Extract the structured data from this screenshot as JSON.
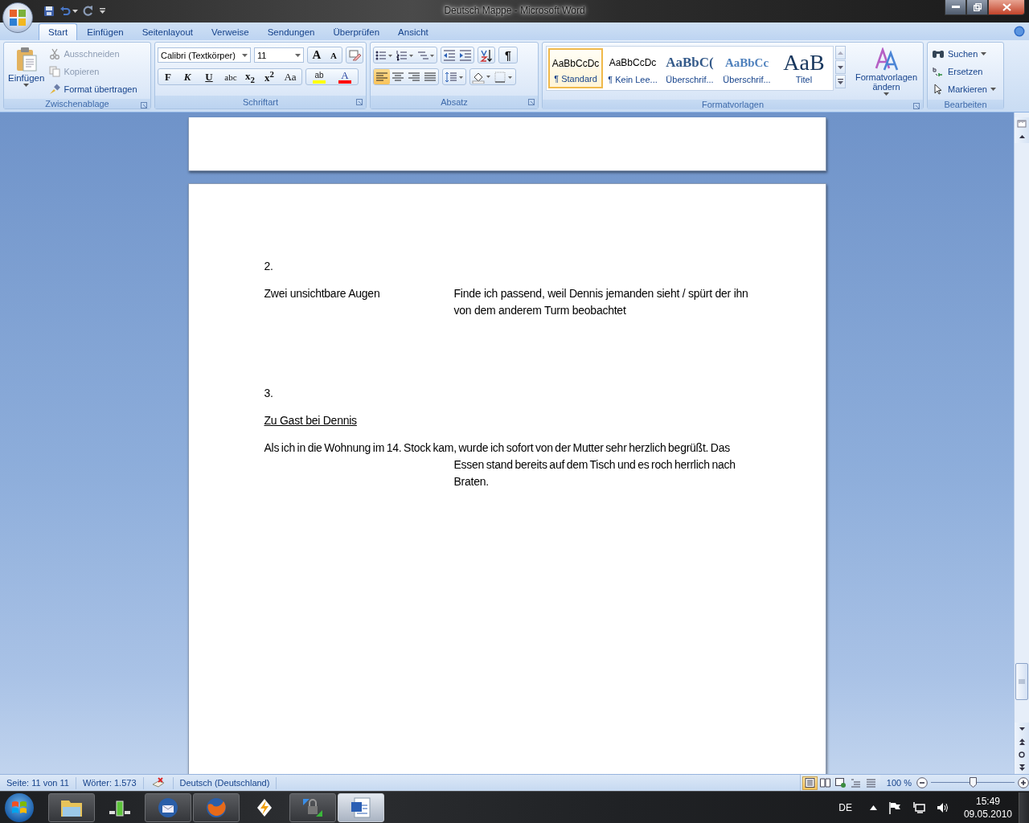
{
  "window": {
    "title": "Deutsch Mappe - Microsoft Word"
  },
  "tabs": [
    {
      "label": "Start",
      "selected": true
    },
    {
      "label": "Einfügen",
      "selected": false
    },
    {
      "label": "Seitenlayout",
      "selected": false
    },
    {
      "label": "Verweise",
      "selected": false
    },
    {
      "label": "Sendungen",
      "selected": false
    },
    {
      "label": "Überprüfen",
      "selected": false
    },
    {
      "label": "Ansicht",
      "selected": false
    }
  ],
  "clipboard": {
    "label": "Zwischenablage",
    "paste": "Einfügen",
    "actions": [
      {
        "label": "Ausschneiden",
        "kind": "cut",
        "disabled": true
      },
      {
        "label": "Kopieren",
        "kind": "copy",
        "disabled": true
      },
      {
        "label": "Format übertragen",
        "kind": "brush",
        "disabled": false
      }
    ]
  },
  "font": {
    "label": "Schriftart",
    "font_name": "Calibri (Textkörper)",
    "font_size": "11",
    "grow": "A",
    "shrink": "A",
    "format_buttons": [
      {
        "text": "F",
        "kind": "bold"
      },
      {
        "text": "K",
        "kind": "italic"
      },
      {
        "text": "U",
        "kind": "underline"
      },
      {
        "text": "abc",
        "kind": "strike"
      },
      {
        "text": "x$_{2}$",
        "kind": "plain"
      },
      {
        "text": "x$^{2}$",
        "kind": "plain"
      },
      {
        "text": "Aa",
        "kind": "case"
      }
    ],
    "highlight": "ab",
    "font_color": "A"
  },
  "paragraph": {
    "label": "Absatz",
    "show_marks": "¶",
    "align": [
      {
        "kind": "left",
        "selected": true
      },
      {
        "kind": "center",
        "selected": false
      },
      {
        "kind": "right",
        "selected": false
      },
      {
        "kind": "justify",
        "selected": false
      }
    ]
  },
  "styles": {
    "label": "Formatvorlagen",
    "change": "Formatvorlagen ändern",
    "items": [
      {
        "preview": "AaBbCcDc",
        "name": "¶ Standard",
        "kind": "normal",
        "selected": true
      },
      {
        "preview": "AaBbCcDc",
        "name": "¶ Kein Lee...",
        "kind": "normal",
        "selected": false
      },
      {
        "preview": "AaBbC(",
        "name": "Überschrif...",
        "kind": "heading1",
        "selected": false
      },
      {
        "preview": "AaBbCc",
        "name": "Überschrif...",
        "kind": "heading2",
        "selected": false
      },
      {
        "preview": "AaB",
        "name": "Titel",
        "kind": "title",
        "selected": false
      }
    ]
  },
  "editing": {
    "label": "Bearbeiten",
    "actions": [
      {
        "label": "Suchen",
        "kind": "find"
      },
      {
        "label": "Ersetzen",
        "kind": "replace"
      },
      {
        "label": "Markieren",
        "kind": "select"
      }
    ]
  },
  "document": {
    "blocks": [
      {
        "kind": "para",
        "text": "2."
      },
      {
        "kind": "row",
        "left": "Zwei unsichtbare Augen",
        "right": "Finde ich passend, weil Dennis jemanden sieht / spürt der ihn von dem anderem Turm beobachtet"
      },
      {
        "kind": "para",
        "text": "3."
      },
      {
        "kind": "heading",
        "text": "Zu Gast bei Dennis"
      },
      {
        "kind": "hanging",
        "text": "Als ich in die Wohnung im 14.  Stock kam, wurde ich sofort von der Mutter sehr herzlich begrüßt. Das Essen stand bereits auf dem Tisch und es roch herrlich nach Braten."
      }
    ]
  },
  "status_bar": {
    "page": "Seite: 11 von 11",
    "words": "Wörter: 1.573",
    "language": "Deutsch (Deutschland)",
    "views": [
      {
        "kind": "print",
        "selected": true
      },
      {
        "kind": "reading",
        "selected": false
      },
      {
        "kind": "web",
        "selected": false
      },
      {
        "kind": "outline",
        "selected": false
      },
      {
        "kind": "draft",
        "selected": false
      }
    ],
    "zoom": "100 %",
    "zoom_slider": {
      "level": 0.5
    }
  },
  "taskbar": {
    "apps": [
      {
        "kind": "folder",
        "running": true,
        "selected": false
      },
      {
        "kind": "gadget",
        "running": false,
        "selected": false
      },
      {
        "kind": "mail",
        "running": true,
        "selected": false
      },
      {
        "kind": "browser",
        "running": true,
        "selected": false
      },
      {
        "kind": "bolt",
        "running": false,
        "selected": false
      },
      {
        "kind": "lock",
        "running": true,
        "selected": false
      },
      {
        "kind": "document",
        "running": true,
        "selected": true
      }
    ],
    "language": "DE",
    "time": "15:49",
    "date": "09.05.2010"
  }
}
